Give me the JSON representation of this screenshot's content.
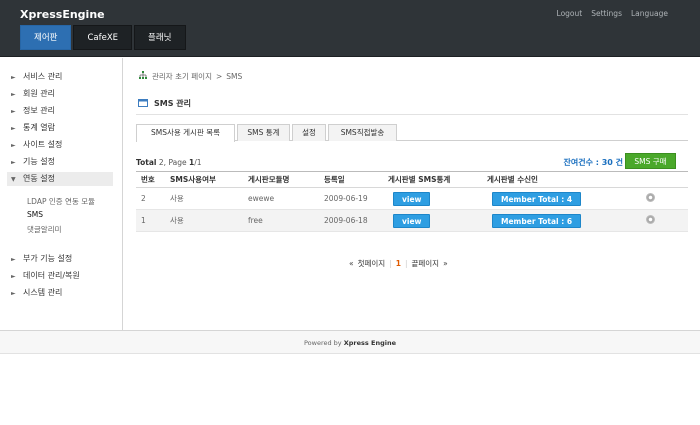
{
  "header": {
    "brand": "XpressEngine",
    "links": [
      "Logout",
      "Settings",
      "Language"
    ],
    "tabs": [
      {
        "label": "제어판",
        "active": true
      },
      {
        "label": "CafeXE",
        "active": false
      },
      {
        "label": "플래닛",
        "active": false
      }
    ]
  },
  "sidebar": {
    "items": [
      {
        "label": "서비스 관리",
        "arrow": "►"
      },
      {
        "label": "회원 관리",
        "arrow": "►"
      },
      {
        "label": "정보 관리",
        "arrow": "►"
      },
      {
        "label": "통계 열람",
        "arrow": "►"
      },
      {
        "label": "사이트 설정",
        "arrow": "►"
      },
      {
        "label": "기능 설정",
        "arrow": "►"
      },
      {
        "label": "연동 설정",
        "arrow": "▼"
      }
    ],
    "subitems": [
      "LDAP 인증 연동 모듈",
      "SMS",
      "댓글알리미"
    ],
    "items2": [
      {
        "label": "부가 기능 설정",
        "arrow": "►"
      },
      {
        "label": "데이터 관리/복원",
        "arrow": "►"
      },
      {
        "label": "시스템 관리",
        "arrow": "►"
      }
    ]
  },
  "breadcrumb": {
    "home": "관리자 초기 페이지",
    "sep": ">",
    "current": "SMS"
  },
  "page_title": "SMS 관리",
  "tabs": [
    "SMS사용 게시판 목록",
    "SMS 통계",
    "설정",
    "SMS직접발송"
  ],
  "summary": {
    "total_label": "Total",
    "total_count": "2",
    "page_label": ", Page",
    "page": "1",
    "page_of": "/1"
  },
  "remain": {
    "label": "잔여건수 : ",
    "value": "30",
    "unit": " 건"
  },
  "buy_button": "SMS 구매",
  "table": {
    "headers": [
      "번호",
      "SMS사용여부",
      "게시판모듈명",
      "등록일",
      "게시판별 SMS통계",
      "게시판별 수신인",
      ""
    ],
    "rows": [
      {
        "no": "2",
        "use": "사용",
        "module": "ewewe",
        "date": "2009-06-19",
        "stats": "view",
        "receivers": "Member Total : 4"
      },
      {
        "no": "1",
        "use": "사용",
        "module": "free",
        "date": "2009-06-18",
        "stats": "view",
        "receivers": "Member Total : 6"
      }
    ]
  },
  "pager": {
    "first": "첫페이지",
    "first_arrow": "«",
    "current": "1",
    "last": "끝페이지",
    "last_arrow": "»",
    "sep": "|"
  },
  "footer": {
    "prefix": "Powered by ",
    "brand": "Xpress Engine"
  }
}
